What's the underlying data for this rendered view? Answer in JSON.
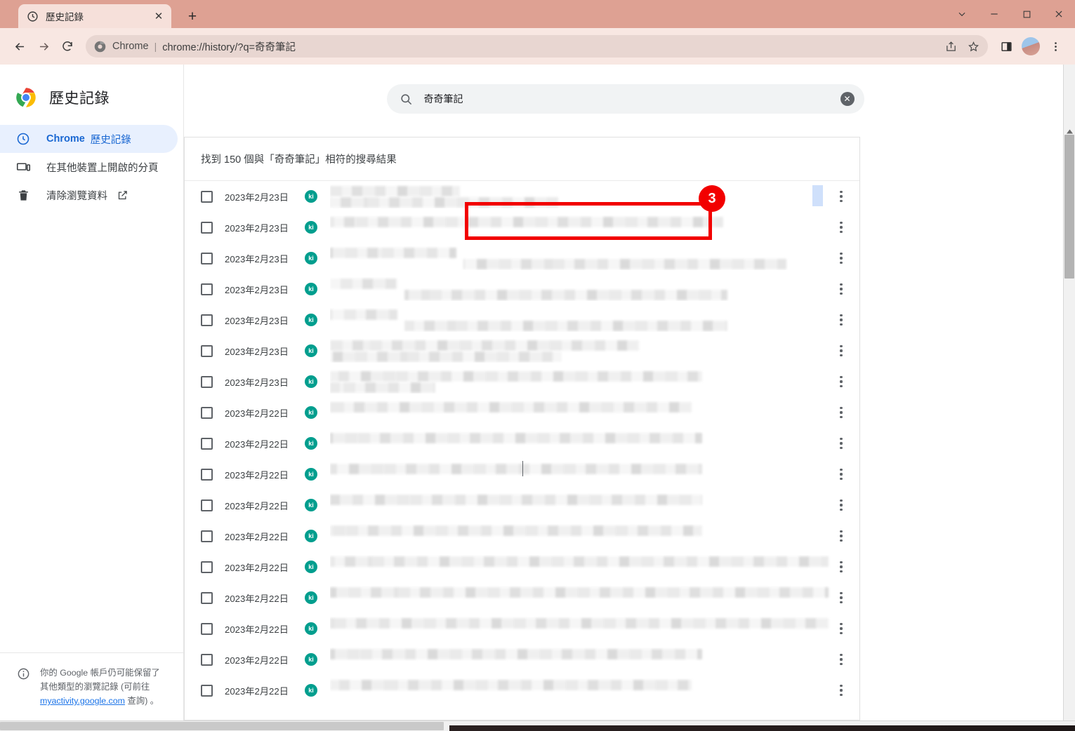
{
  "window": {
    "controls": [
      {
        "name": "tab-search-chevron",
        "glyph": "⌄"
      },
      {
        "name": "minimize",
        "glyph": "–"
      },
      {
        "name": "maximize",
        "glyph": "□"
      },
      {
        "name": "close",
        "glyph": "✕"
      }
    ]
  },
  "tab": {
    "title": "歷史記錄",
    "favicon": "history-clock-icon",
    "close_label": "✕",
    "newtab_label": "+"
  },
  "toolbar": {
    "back_label": "←",
    "forward_label": "→",
    "reload_label": "⟳",
    "omnibox": {
      "icon": "chrome-logo-icon",
      "scheme_label": "Chrome",
      "separator": "|",
      "url": "chrome://history/?q=奇奇筆記"
    },
    "share_label": "share-icon",
    "bookmark_label": "☆",
    "side_panel_label": "side-panel-icon",
    "profile_label": "avatar",
    "menu_label": "⋮"
  },
  "sidebar": {
    "brand_title": "歷史記錄",
    "items": [
      {
        "label_bold": "Chrome",
        "label": "歷史記錄",
        "icon": "clock-icon",
        "selected": true
      },
      {
        "label_bold": "",
        "label": "在其他裝置上開啟的分頁",
        "icon": "devices-icon",
        "selected": false
      },
      {
        "label_bold": "",
        "label": "清除瀏覽資料",
        "icon": "trash-icon",
        "selected": false,
        "external": true
      }
    ],
    "footer": {
      "icon": "info-icon",
      "line1": "你的 Google 帳戶仍可能保留了",
      "line2": "其他類型的瀏覽記錄 (可前往",
      "link": "myactivity.google.com",
      "line3": "查詢) 。"
    }
  },
  "search": {
    "icon": "search-icon",
    "value": "奇奇筆記",
    "clear_label": "✕"
  },
  "results": {
    "header": "找到 150 個與「奇奇筆記」相符的搜尋結果",
    "count": 150,
    "query": "奇奇筆記",
    "favicon_letters": "ki",
    "favicon_color": "#009e8e",
    "rows": [
      {
        "date": "2023年2月23日",
        "bands": [
          [
            0,
            185
          ],
          [
            0,
            325
          ]
        ],
        "selected_chip": true
      },
      {
        "date": "2023年2月23日",
        "bands": [
          [
            0,
            560
          ]
        ]
      },
      {
        "date": "2023年2月23日",
        "bands": [
          [
            0,
            180
          ],
          [
            190,
            460
          ]
        ]
      },
      {
        "date": "2023年2月23日",
        "bands": [
          [
            0,
            96
          ],
          [
            106,
            460
          ]
        ]
      },
      {
        "date": "2023年2月23日",
        "bands": [
          [
            0,
            96
          ],
          [
            106,
            460
          ]
        ]
      },
      {
        "date": "2023年2月23日",
        "bands": [
          [
            0,
            440
          ],
          [
            0,
            330
          ]
        ]
      },
      {
        "date": "2023年2月23日",
        "bands": [
          [
            0,
            530
          ],
          [
            0,
            150
          ]
        ]
      },
      {
        "date": "2023年2月22日",
        "bands": [
          [
            0,
            515
          ]
        ]
      },
      {
        "date": "2023年2月22日",
        "bands": [
          [
            0,
            530
          ]
        ]
      },
      {
        "date": "2023年2月22日",
        "bands": [
          [
            0,
            530
          ]
        ]
      },
      {
        "date": "2023年2月22日",
        "bands": [
          [
            0,
            530
          ]
        ]
      },
      {
        "date": "2023年2月22日",
        "bands": [
          [
            0,
            530
          ]
        ]
      },
      {
        "date": "2023年2月22日",
        "bands": [
          [
            0,
            710
          ]
        ]
      },
      {
        "date": "2023年2月22日",
        "bands": [
          [
            0,
            710
          ]
        ]
      },
      {
        "date": "2023年2月22日",
        "bands": [
          [
            0,
            710
          ]
        ]
      },
      {
        "date": "2023年2月22日",
        "bands": [
          [
            0,
            530
          ]
        ]
      },
      {
        "date": "2023年2月22日",
        "bands": [
          [
            0,
            515
          ]
        ]
      }
    ],
    "row_menu_label": "⋮"
  },
  "annotation": {
    "badge_number": "3",
    "color": "#f20000"
  }
}
